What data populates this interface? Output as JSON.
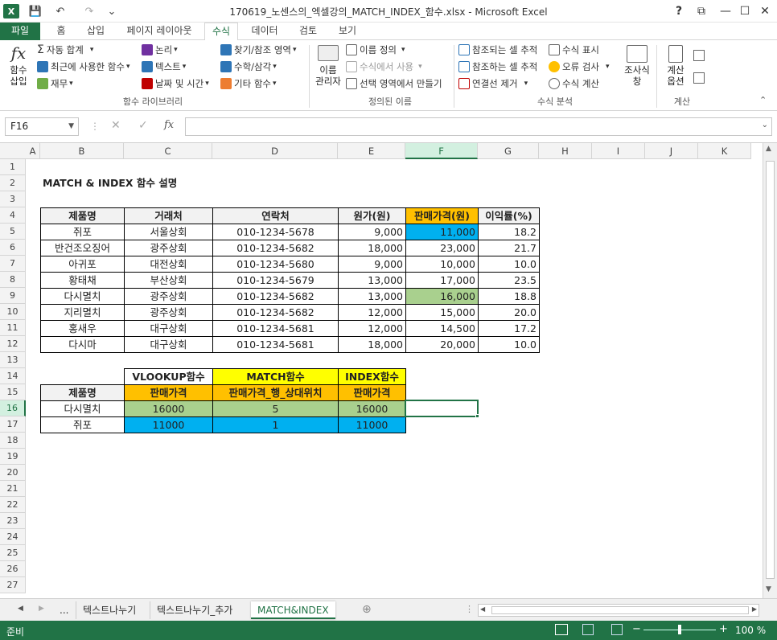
{
  "window": {
    "title": "170619_노센스의_엑셀강의_MATCH_INDEX_함수.xlsx - Microsoft Excel",
    "help": "?",
    "ribbon_display": "⧉",
    "minimize": "—",
    "maximize": "☐",
    "close": "✕",
    "quick_access": {
      "save": "💾",
      "undo": "↶",
      "redo": "↷",
      "customize": "⌄"
    }
  },
  "tabs": [
    "파일",
    "홈",
    "삽입",
    "페이지 레이아웃",
    "수식",
    "데이터",
    "검토",
    "보기"
  ],
  "ribbon": {
    "function_library": {
      "insert_function": [
        "함수",
        "삽입"
      ],
      "autosum": "자동 합계",
      "recent": "최근에 사용한 함수",
      "financial": "재무",
      "logical": "논리",
      "text": "텍스트",
      "datetime": "날짜 및 시간",
      "lookup": "찾기/참조 영역",
      "math": "수학/삼각",
      "more": "기타 함수",
      "group_label": "함수 라이브러리"
    },
    "defined_names": {
      "name_manager": [
        "이름",
        "관리자"
      ],
      "define_name": "이름 정의",
      "use_in_formula": "수식에서 사용",
      "create_from_selection": "선택 영역에서 만들기",
      "group_label": "정의된 이름"
    },
    "formula_auditing": {
      "trace_precedents": "참조되는 셀 추적",
      "trace_dependents": "참조하는 셀 추적",
      "remove_arrows": "연결선 제거",
      "show_formulas": "수식 표시",
      "error_checking": "오류 검사",
      "evaluate_formula": "수식 계산",
      "watch_window": [
        "조사식",
        "창"
      ],
      "group_label": "수식 분석"
    },
    "calculation": {
      "options": [
        "계산",
        "옵션"
      ],
      "group_label": "계산"
    }
  },
  "formula_bar": {
    "name_box": "F16",
    "cancel": "✕",
    "enter": "✓",
    "fx": "fx",
    "formula": ""
  },
  "columns": [
    "A",
    "B",
    "C",
    "D",
    "E",
    "F",
    "G",
    "H",
    "I",
    "J",
    "K"
  ],
  "rows": [
    "1",
    "2",
    "3",
    "4",
    "5",
    "6",
    "7",
    "8",
    "9",
    "10",
    "11",
    "12",
    "13",
    "14",
    "15",
    "16",
    "17",
    "18",
    "19",
    "20",
    "21",
    "22",
    "23",
    "24",
    "25",
    "26",
    "27"
  ],
  "sheet": {
    "title": "MATCH & INDEX 함수 설명",
    "table_headers": [
      "제품명",
      "거래처",
      "연락처",
      "원가(원)",
      "판매가격(원)",
      "이익률(%)"
    ],
    "table_rows": [
      [
        "쥐포",
        "서울상회",
        "010-1234-5678",
        "9,000",
        "11,000",
        "18.2"
      ],
      [
        "반건조오징어",
        "광주상회",
        "010-1234-5682",
        "18,000",
        "23,000",
        "21.7"
      ],
      [
        "아귀포",
        "대전상회",
        "010-1234-5680",
        "9,000",
        "10,000",
        "10.0"
      ],
      [
        "황태채",
        "부산상회",
        "010-1234-5679",
        "13,000",
        "17,000",
        "23.5"
      ],
      [
        "다시멸치",
        "광주상회",
        "010-1234-5682",
        "13,000",
        "16,000",
        "18.8"
      ],
      [
        "지리멸치",
        "광주상회",
        "010-1234-5682",
        "12,000",
        "15,000",
        "20.0"
      ],
      [
        "홍새우",
        "대구상회",
        "010-1234-5681",
        "12,000",
        "14,500",
        "17.2"
      ],
      [
        "다시마",
        "대구상회",
        "010-1234-5681",
        "18,000",
        "20,000",
        "10.0"
      ]
    ],
    "lookup_top_headers": [
      "VLOOKUP함수",
      "MATCH함수",
      "INDEX함수"
    ],
    "lookup_sub_headers": [
      "제품명",
      "판매가격",
      "판매가격_행_상대위치",
      "판매가격"
    ],
    "lookup_rows": [
      [
        "다시멸치",
        "16000",
        "5",
        "16000"
      ],
      [
        "쥐포",
        "11000",
        "1",
        "11000"
      ]
    ]
  },
  "sheet_tabs": {
    "ellipsis": "...",
    "tabs": [
      "텍스트나누기",
      "텍스트나누기_추가",
      "MATCH&INDEX"
    ],
    "active_index": 2,
    "add": "⊕"
  },
  "status": {
    "mode": "준비",
    "zoom": "100 %",
    "zoom_level": 100
  },
  "colors": {
    "excel_green": "#217346",
    "header_orange": "#FFC000",
    "header_yellow": "#FFFF00",
    "highlight_blue": "#00B0F0",
    "highlight_green": "#A9D08E"
  }
}
